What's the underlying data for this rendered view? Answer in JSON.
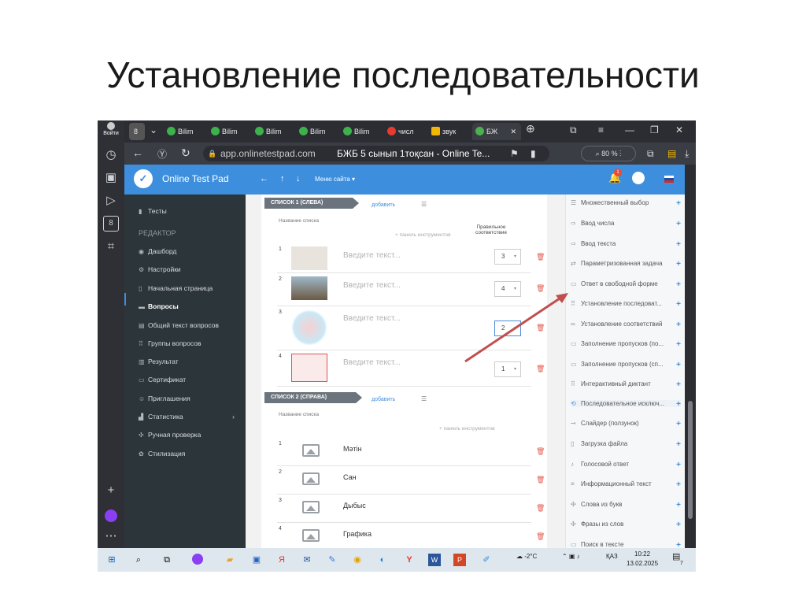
{
  "slide": {
    "title": "Установление последовательности"
  },
  "browser": {
    "login_label": "Войти",
    "tabs": [
      {
        "label": "8",
        "icon": "badge-8-icon"
      },
      {
        "label": "Bilim",
        "icon": "green-circle-icon"
      },
      {
        "label": "Bilim",
        "icon": "green-circle-icon"
      },
      {
        "label": "Bilim",
        "icon": "green-circle-icon"
      },
      {
        "label": "Bilim",
        "icon": "green-circle-icon"
      },
      {
        "label": "Bilim",
        "icon": "green-circle-icon"
      },
      {
        "label": "числ",
        "icon": "yandex-icon"
      },
      {
        "label": "звук",
        "icon": "image-icon"
      },
      {
        "label": "БЖ",
        "icon": "onlinetestpad-icon"
      }
    ],
    "url_site": "app.onlinetestpad.com",
    "page_title": "БЖБ 5 сынып 1тоқсан - Online Te...",
    "zoom": "80 %"
  },
  "app": {
    "title": "Online Test Pad",
    "menu_label": "Меню сайта",
    "notification_count": "1"
  },
  "leftnav": {
    "tests": "Тесты",
    "section": "РЕДАКТОР",
    "items": [
      "Дашборд",
      "Настройки",
      "Начальная страница",
      "Вопросы",
      "Общий текст вопросов",
      "Группы вопросов",
      "Результат",
      "Сертификат",
      "Приглашения",
      "Статистика",
      "Ручная проверка",
      "Стилизация"
    ]
  },
  "editor": {
    "list1_header": "СПИСОК 1 (СЛЕВА)",
    "list2_header": "СПИСОК 2 (СПРАВА)",
    "add_label": "добавить",
    "list_name_label": "Название списка",
    "toolbar_label": "+ панель инструментов",
    "correct_label_1": "Правильное",
    "correct_label_2": "соответствие",
    "list1": [
      {
        "num": "1",
        "placeholder": "Введите текст...",
        "match": "3"
      },
      {
        "num": "2",
        "placeholder": "Введите текст...",
        "match": "4"
      },
      {
        "num": "3",
        "placeholder": "Введите текст...",
        "match": "2"
      },
      {
        "num": "4",
        "placeholder": "Введите текст...",
        "match": "1"
      }
    ],
    "list2": [
      {
        "num": "1",
        "text": "Мәтін"
      },
      {
        "num": "2",
        "text": "Сан"
      },
      {
        "num": "3",
        "text": "Дыбыс"
      },
      {
        "num": "4",
        "text": "Графика"
      }
    ]
  },
  "question_types": [
    "Множественный выбор",
    "Ввод числа",
    "Ввод текста",
    "Параметризованная задача",
    "Ответ в свободной форме",
    "Установление последоват...",
    "Установление соответствий",
    "Заполнение пропусков (по...",
    "Заполнение пропусков (сп...",
    "Интерактивный диктант",
    "Последовательное исключ...",
    "Слайдер (ползунок)",
    "Загрузка файла",
    "Голосовой ответ",
    "Информационный текст",
    "Слова из букв",
    "Фразы из слов",
    "Поиск в тексте"
  ],
  "taskbar": {
    "weather": "-2°C",
    "lang": "ҚАЗ",
    "time": "10:22",
    "date": "13.02.2025",
    "notif_count": "7"
  },
  "colors": {
    "header": "#3d8fde",
    "annotation_arrow": "#c0504d"
  }
}
